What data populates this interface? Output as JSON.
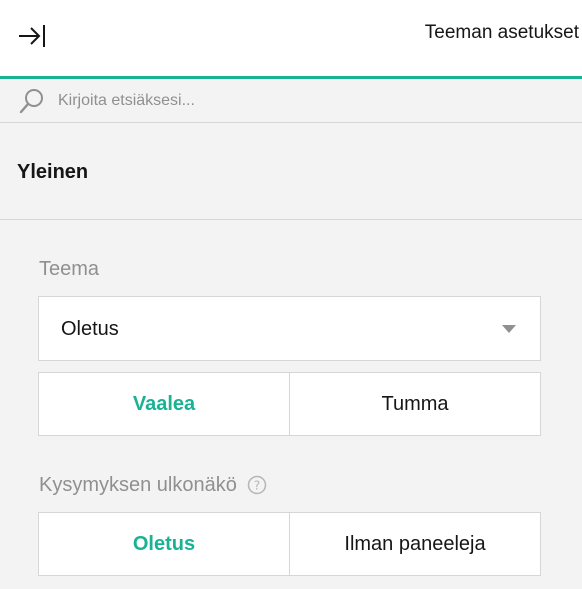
{
  "header": {
    "collapse_icon": "collapse-right-arrow-icon",
    "title": "Teeman asetukset"
  },
  "search": {
    "icon": "search-icon",
    "placeholder": "Kirjoita etsiäksesi..."
  },
  "section": {
    "title": "Yleinen"
  },
  "theme": {
    "label": "Teema",
    "selected": "Oletus",
    "arrow_icon": "chevron-down-icon",
    "modes": [
      {
        "label": "Vaalea",
        "active": true
      },
      {
        "label": "Tumma",
        "active": false
      }
    ]
  },
  "question_appearance": {
    "label": "Kysymyksen ulkonäkö",
    "help_icon": "help-circle-icon",
    "options": [
      {
        "label": "Oletus",
        "active": true
      },
      {
        "label": "Ilman paneeleja",
        "active": false
      }
    ]
  },
  "colors": {
    "accent": "#19b394",
    "background": "#f3f3f3",
    "border": "#d6d6d6",
    "label_gray": "#909090"
  }
}
